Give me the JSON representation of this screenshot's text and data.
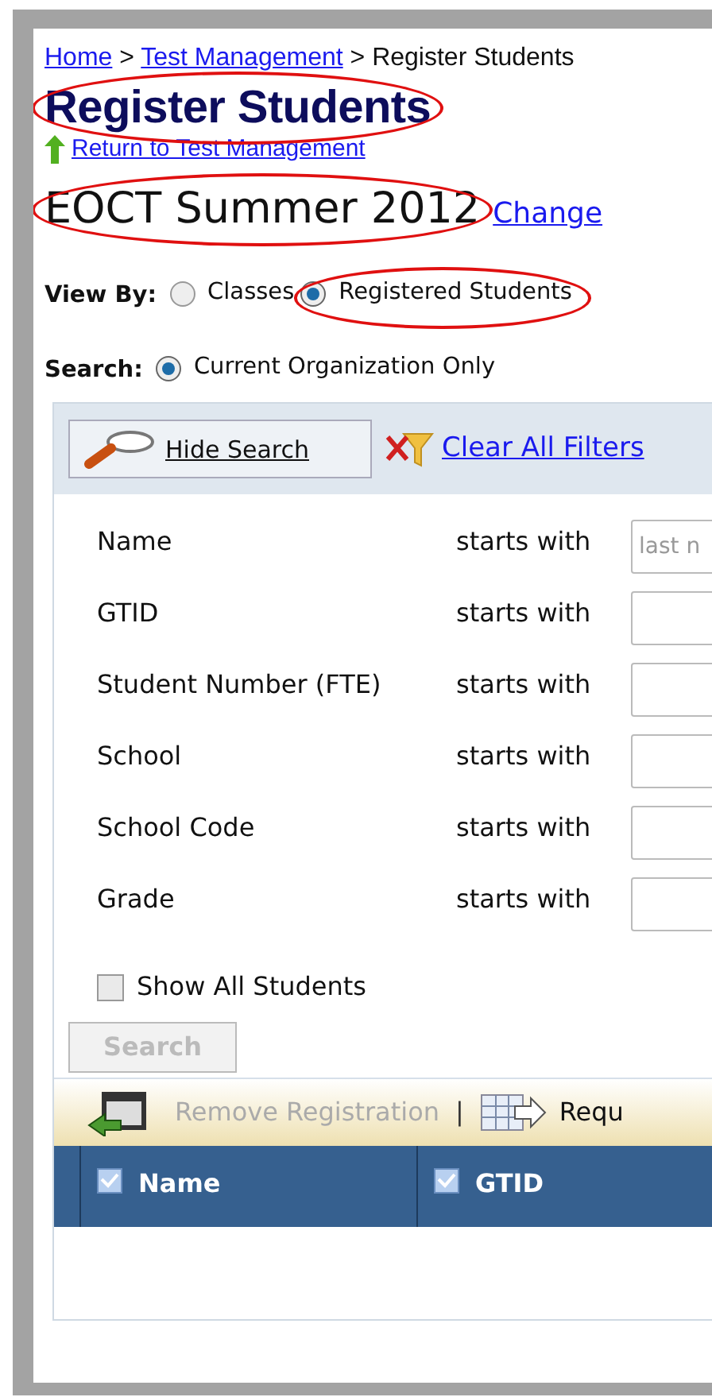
{
  "breadcrumb": [
    {
      "kind": "link",
      "label": "Home"
    },
    {
      "kind": "separator",
      "label": ">"
    },
    {
      "kind": "link",
      "label": "Test Management"
    },
    {
      "kind": "separator",
      "label": ">"
    },
    {
      "kind": "current",
      "label": "Register Students"
    }
  ],
  "title": {
    "text": "Register Students",
    "circled": true
  },
  "return_link": "Return to Test Management",
  "test": {
    "name": "EOCT Summer 2012",
    "circled": true,
    "change_link": "Change"
  },
  "view_by": {
    "label": "View By:",
    "options": [
      {
        "label": "Classes",
        "selected": false,
        "circled": false
      },
      {
        "label": "Registered Students",
        "selected": true,
        "circled": true
      }
    ]
  },
  "search_scope": {
    "label": "Search:",
    "options": [
      {
        "label": "Current Organization Only",
        "selected": true,
        "circled": false
      }
    ]
  },
  "search_panel": {
    "hide_button": "Hide Search",
    "clear_link": "Clear All Filters",
    "filters": [
      {
        "label": "Name",
        "operator": "starts with",
        "placeholder": "last n"
      },
      {
        "label": "GTID",
        "operator": "starts with"
      },
      {
        "label": "Student Number (FTE)",
        "operator": "starts with"
      },
      {
        "label": "School",
        "operator": "starts with"
      },
      {
        "label": "School Code",
        "operator": "starts with"
      },
      {
        "label": "Grade",
        "operator": "starts with"
      }
    ],
    "show_all": {
      "label": "Show All Students",
      "checked": false
    },
    "search_button": {
      "label": "Search",
      "disabled": true
    }
  },
  "toolbar": [
    {
      "kind": "remove",
      "label": "Remove Registration",
      "disabled": true
    },
    {
      "kind": "separator",
      "label": "|"
    },
    {
      "kind": "request",
      "label": "Requ",
      "disabled": false
    }
  ],
  "table": {
    "columns": [
      {
        "label": "Name",
        "checked": true
      },
      {
        "label": "GTID",
        "checked": true
      }
    ]
  }
}
